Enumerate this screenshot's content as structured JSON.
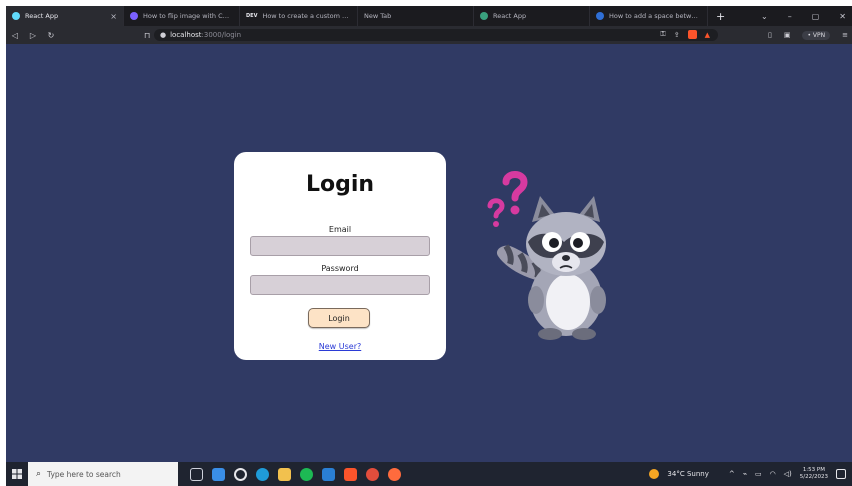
{
  "browser": {
    "tabs": [
      {
        "label": "React App",
        "icon_color": "#61dafb",
        "active": true
      },
      {
        "label": "How to flip image with CSS? · St",
        "icon_color": "#7b61ff"
      },
      {
        "label": "How to create a custom file uplo",
        "icon_color": "#444444",
        "prefix": "DEV"
      },
      {
        "label": "New Tab",
        "icon_color": ""
      },
      {
        "label": "React App",
        "icon_color": "#3aa17e"
      },
      {
        "label": "How to add a space between the",
        "icon_color": "#2f6fd6"
      }
    ],
    "tab_close": "×",
    "new_tab": "+",
    "window_controls": {
      "minimize": "–",
      "restore": "▢",
      "close": "✕"
    },
    "url_host": "localhost",
    "url_path": ":3000/login",
    "vpn_label": "• VPN"
  },
  "login": {
    "title": "Login",
    "email_label": "Email",
    "email_value": "",
    "password_label": "Password",
    "password_value": "",
    "submit_label": "Login",
    "new_user_link": "New User?"
  },
  "taskbar": {
    "search_placeholder": "Type here to search",
    "weather": "34°C  Sunny",
    "time": "1:53 PM",
    "date": "5/22/2023"
  },
  "colors": {
    "background": "#303a64",
    "card": "#ffffff",
    "input_fill": "#d7d0d7",
    "button_fill": "#fde3c6",
    "link": "#2b3bd6",
    "question_marks": "#d63aa0"
  },
  "icons": {
    "illustration": "confused-raccoon-illustration",
    "question_mark": "question-mark-icon"
  }
}
